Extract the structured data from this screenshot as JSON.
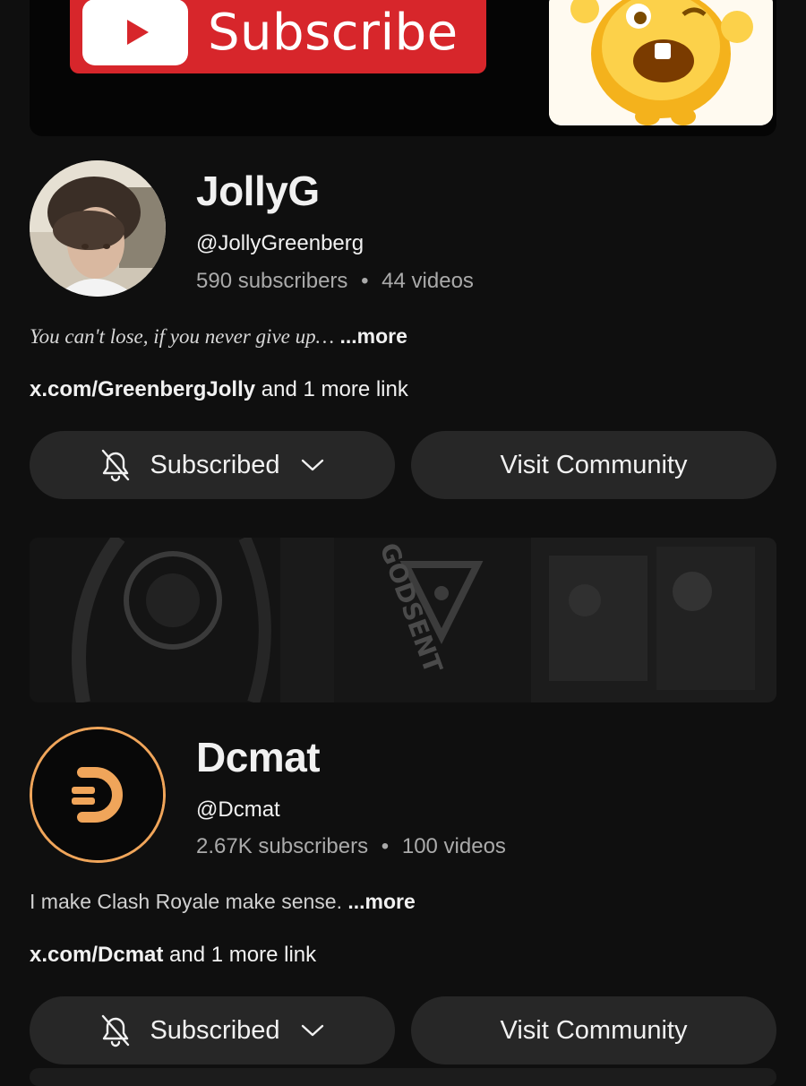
{
  "banner1": {
    "subscribe_label": "Subscribe",
    "colors": {
      "youtube_red": "#d7262b",
      "mascot_yellow": "#f4b21c"
    }
  },
  "channels": [
    {
      "name": "JollyG",
      "handle": "@JollyGreenberg",
      "subscribers": "590 subscribers",
      "separator": "•",
      "videos": "44 videos",
      "description": "You can't lose, if you never give up…",
      "more_label": "...more",
      "link": "x.com/GreenbergJolly",
      "link_suffix": " and 1 more link",
      "subscribed_label": "Subscribed",
      "visit_label": "Visit Community"
    },
    {
      "name": "Dcmat",
      "handle": "@Dcmat",
      "subscribers": "2.67K subscribers",
      "separator": "•",
      "videos": "100 videos",
      "description": "I make Clash Royale make sense.",
      "more_label": "...more",
      "link": "x.com/Dcmat",
      "link_suffix": " and 1 more link",
      "subscribed_label": "Subscribed",
      "visit_label": "Visit Community",
      "banner_text": "GODSENT",
      "avatar_ring_color": "#f0a55a"
    }
  ],
  "icons": {
    "bell_off": "bell-off-icon",
    "chevron_down": "chevron-down-icon",
    "play": "play-icon"
  }
}
